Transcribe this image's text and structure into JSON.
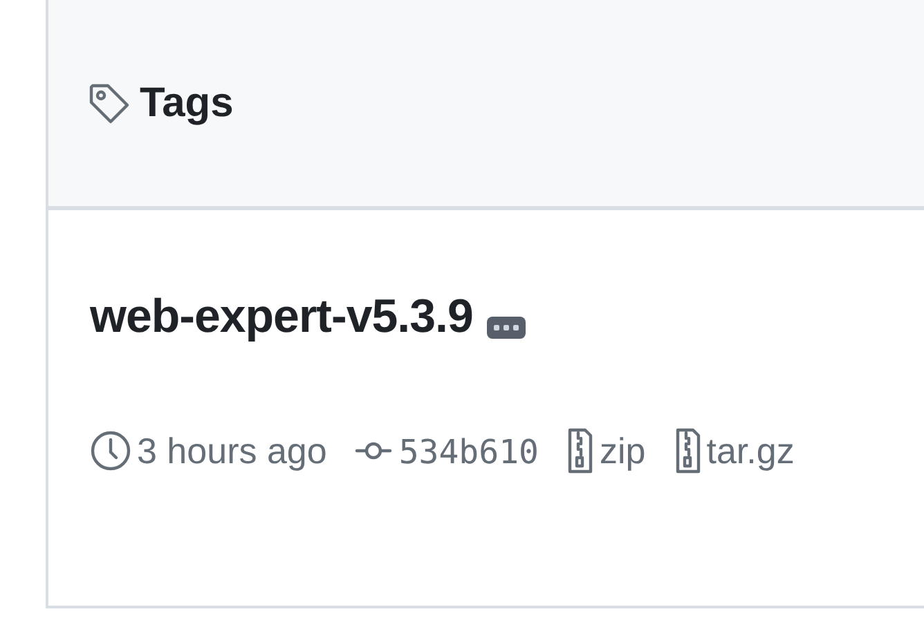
{
  "header": {
    "title": "Tags"
  },
  "tags": [
    {
      "name": "web-expert-v5.3.9",
      "time": "3 hours ago",
      "commit": "534b610",
      "downloads": [
        "zip",
        "tar.gz"
      ]
    }
  ]
}
